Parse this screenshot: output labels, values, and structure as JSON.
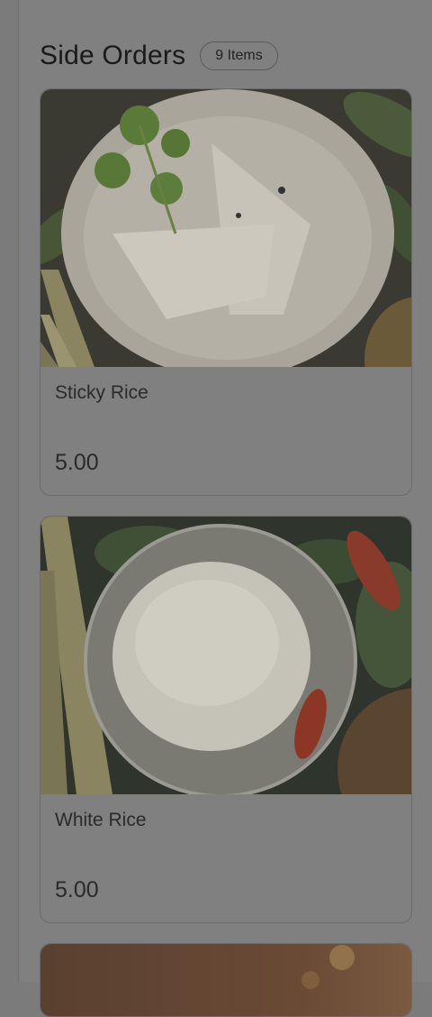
{
  "section": {
    "title": "Side Orders",
    "count_badge": "9 Items"
  },
  "items": [
    {
      "name": "Sticky Rice",
      "price": "5.00",
      "image": "sticky-rice-image"
    },
    {
      "name": "White Rice",
      "price": "5.00",
      "image": "white-rice-image"
    }
  ],
  "colors": {
    "overlay": "#808080",
    "text": "#2a2a2a",
    "border": "#6b6b6b"
  }
}
